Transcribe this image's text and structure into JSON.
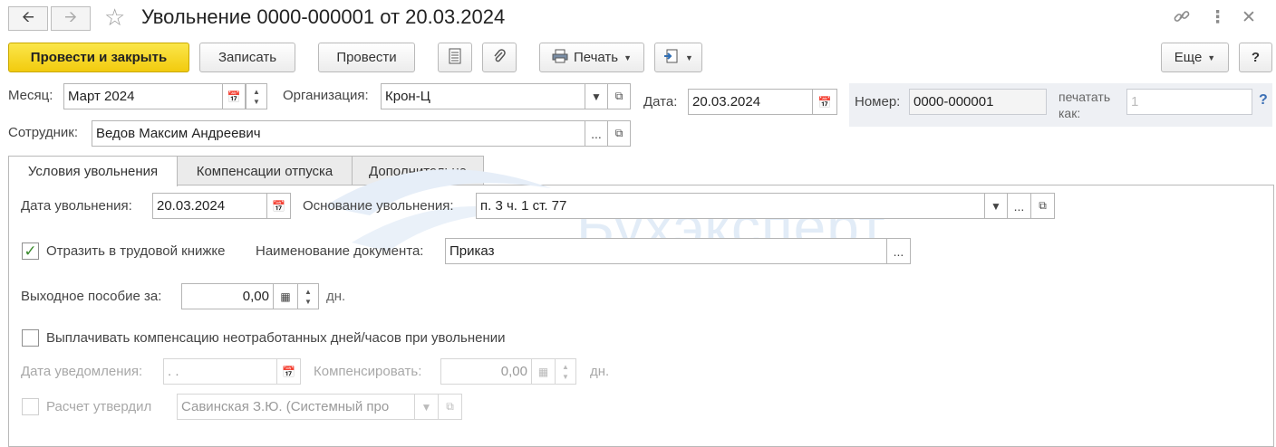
{
  "window": {
    "title": "Увольнение 0000-000001 от 20.03.2024"
  },
  "toolbar": {
    "post_close": "Провести и закрыть",
    "save": "Записать",
    "post": "Провести",
    "print": "Печать",
    "more": "Еще",
    "help": "?"
  },
  "header": {
    "month_label": "Месяц:",
    "month_value": "Март 2024",
    "org_label": "Организация:",
    "org_value": "Крон-Ц",
    "date_label": "Дата:",
    "date_value": "20.03.2024",
    "number_label": "Номер:",
    "number_value": "0000-000001",
    "print_as_label_1": "печатать",
    "print_as_label_2": "как:",
    "print_as_placeholder": "1",
    "employee_label": "Сотрудник:",
    "employee_value": "Ведов Максим Андреевич"
  },
  "tabs": [
    {
      "label": "Условия увольнения"
    },
    {
      "label": "Компенсации отпуска"
    },
    {
      "label": "Дополнительно"
    }
  ],
  "conditions": {
    "dismissal_date_label": "Дата увольнения:",
    "dismissal_date_value": "20.03.2024",
    "basis_label": "Основание увольнения:",
    "basis_value": "п. 3 ч. 1 ст. 77",
    "workbook_checkbox_label": "Отразить в трудовой книжке",
    "workbook_checked": true,
    "doc_name_label": "Наименование документа:",
    "doc_name_value": "Приказ",
    "severance_label": "Выходное пособие за:",
    "severance_value": "0,00",
    "days_unit": "дн.",
    "compensation_checkbox_label": "Выплачивать компенсацию неотработанных дней/часов при увольнении",
    "compensation_checked": false,
    "notice_date_label": "Дата уведомления:",
    "notice_date_value": " .  .",
    "compensate_label": "Компенсировать:",
    "compensate_value": "0,00",
    "approved_label": "Расчет утвердил",
    "approved_value": "Савинская З.Ю. (Системный про"
  },
  "watermark": {
    "text": "Бухэксперт"
  },
  "colors": {
    "primary_button": "#f5d21c",
    "check_mark": "#3a8a2c",
    "help_link": "#3b6fb5",
    "number_panel": "#eef0f4"
  }
}
